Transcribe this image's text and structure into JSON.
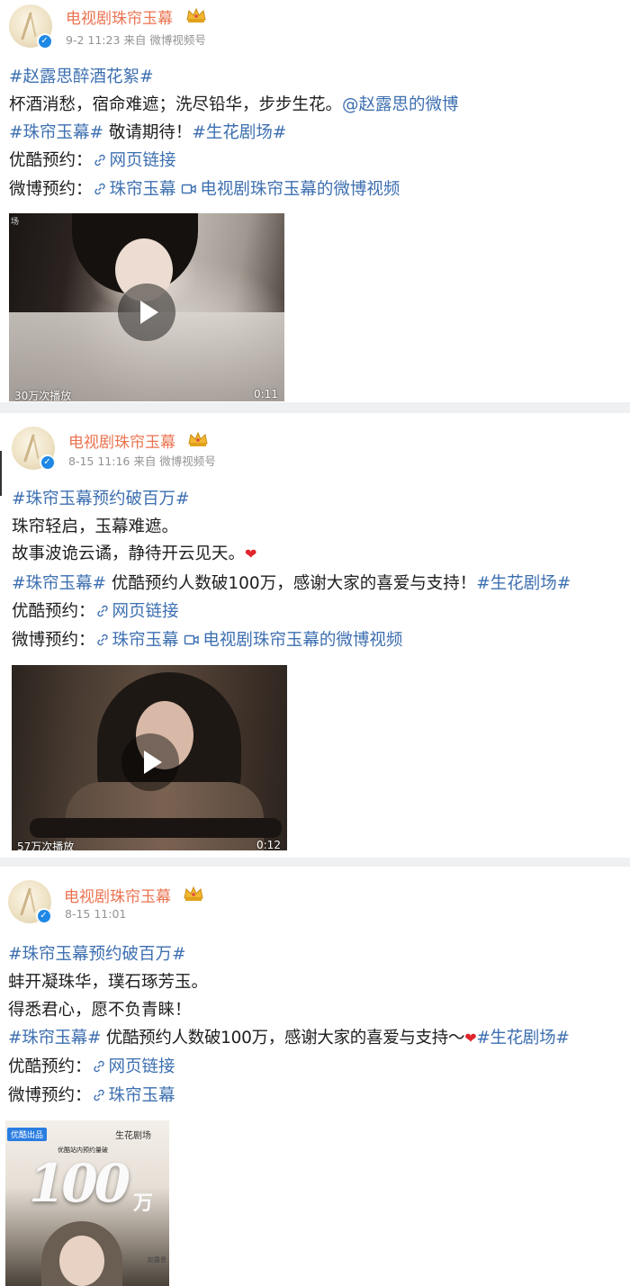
{
  "posts": [
    {
      "author": "电视剧珠帘玉幕",
      "meta": "9-2 11:23 来自 微博视频号",
      "lines": {
        "tag1": "#赵露思醉酒花絮#",
        "text1": "杯酒消愁，宿命难遮；洗尽铅华，步步生花。",
        "at1": "@赵露思的微博",
        "tag2": "#珠帘玉幕#",
        "text2": " 敬请期待！",
        "tag3": "#生花剧场#",
        "youku_label": "优酷预约：",
        "youku_link": "网页链接",
        "weibo_label": "微博预约：",
        "weibo_link1": "珠帘玉幕",
        "weibo_link2": "电视剧珠帘玉幕的微博视频"
      },
      "video": {
        "plays": "30万次播放",
        "duration": "0:11",
        "corner_text": "场"
      }
    },
    {
      "author": "电视剧珠帘玉幕",
      "meta": "8-15 11:16 来自 微博视频号",
      "lines": {
        "tag1": "#珠帘玉幕预约破百万#",
        "text1": "珠帘轻启，玉幕难遮。",
        "text2": "故事波诡云谲，静待开云见天。",
        "tag2": "#珠帘玉幕#",
        "text3": " 优酷预约人数破100万，感谢大家的喜爱与支持！",
        "tag3": "#生花剧场#",
        "youku_label": "优酷预约：",
        "youku_link": "网页链接",
        "weibo_label": "微博预约：",
        "weibo_link1": "珠帘玉幕",
        "weibo_link2": "电视剧珠帘玉幕的微博视频"
      },
      "video": {
        "plays": "57万次播放",
        "duration": "0:12"
      }
    },
    {
      "author": "电视剧珠帘玉幕",
      "meta": "8-15 11:01",
      "lines": {
        "tag1": "#珠帘玉幕预约破百万#",
        "text1": "蚌开凝珠华，璞石琢芳玉。",
        "text2": "得悉君心，愿不负青睐！",
        "tag2": "#珠帘玉幕#",
        "text3": " 优酷预约人数破100万，感谢大家的喜爱与支持～",
        "tag3": "#生花剧场#",
        "youku_label": "优酷预约：",
        "youku_link": "网页链接",
        "weibo_label": "微博预约：",
        "weibo_link1": "珠帘玉幕"
      },
      "poster": {
        "badge": "优酷出品",
        "logo": "生花剧场",
        "subtitle": "优酷站内预约量破",
        "big": "100",
        "unit": "万",
        "corner": "赵露思"
      }
    }
  ],
  "colors": {
    "name": "#eb7350",
    "link": "#3d6fb0",
    "verified": "#1f88e5",
    "heart": "#e0242b"
  }
}
